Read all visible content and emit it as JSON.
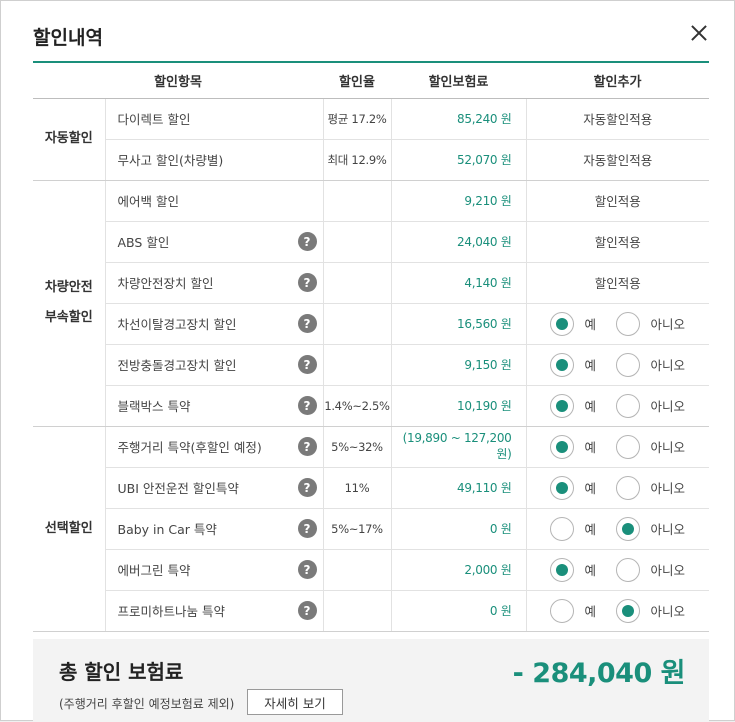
{
  "modal": {
    "title": "할인내역"
  },
  "table": {
    "headers": [
      "할인항목",
      "할인율",
      "할인보험료",
      "할인추가"
    ],
    "groups": [
      {
        "label_lines": [
          "자동할인"
        ],
        "rows": [
          {
            "name": "다이렉트 할인",
            "help": false,
            "rate": "평균 17.2%",
            "amount": "85,240 원",
            "apply": {
              "type": "text",
              "text": "자동할인적용"
            }
          },
          {
            "name": "무사고 할인(차량별)",
            "help": false,
            "rate": "최대 12.9%",
            "amount": "52,070 원",
            "apply": {
              "type": "text",
              "text": "자동할인적용"
            }
          }
        ]
      },
      {
        "label_lines": [
          "차량안전",
          "부속할인"
        ],
        "rows": [
          {
            "name": "에어백 할인",
            "help": false,
            "rate": "",
            "amount": "9,210 원",
            "apply": {
              "type": "text",
              "text": "할인적용"
            }
          },
          {
            "name": "ABS 할인",
            "help": true,
            "rate": "",
            "amount": "24,040 원",
            "apply": {
              "type": "text",
              "text": "할인적용"
            }
          },
          {
            "name": "차량안전장치 할인",
            "help": true,
            "rate": "",
            "amount": "4,140 원",
            "apply": {
              "type": "text",
              "text": "할인적용"
            }
          },
          {
            "name": "차선이탈경고장치 할인",
            "help": true,
            "rate": "",
            "amount": "16,560 원",
            "apply": {
              "type": "radio",
              "selected": "yes"
            }
          },
          {
            "name": "전방충돌경고장치 할인",
            "help": true,
            "rate": "",
            "amount": "9,150 원",
            "apply": {
              "type": "radio",
              "selected": "yes"
            }
          },
          {
            "name": "블랙박스 특약",
            "help": true,
            "rate": "1.4%~2.5%",
            "amount": "10,190 원",
            "apply": {
              "type": "radio",
              "selected": "yes"
            }
          }
        ]
      },
      {
        "label_lines": [
          "선택할인"
        ],
        "rows": [
          {
            "name": "주행거리 특약(후할인 예정)",
            "help": true,
            "rate": "5%~32%",
            "amount": "(19,890 ~ 127,200 원)",
            "apply": {
              "type": "radio",
              "selected": "yes"
            }
          },
          {
            "name": "UBI 안전운전 할인특약",
            "help": true,
            "rate": "11%",
            "amount": "49,110 원",
            "apply": {
              "type": "radio",
              "selected": "yes"
            }
          },
          {
            "name": "Baby in Car 특약",
            "help": true,
            "rate": "5%~17%",
            "amount": "0 원",
            "apply": {
              "type": "radio",
              "selected": "no"
            }
          },
          {
            "name": "에버그린 특약",
            "help": true,
            "rate": "",
            "amount": "2,000 원",
            "apply": {
              "type": "radio",
              "selected": "yes"
            }
          },
          {
            "name": "프로미하트나눔 특약",
            "help": true,
            "rate": "",
            "amount": "0 원",
            "apply": {
              "type": "radio",
              "selected": "no"
            }
          }
        ]
      }
    ],
    "radio_labels": {
      "yes": "예",
      "no": "아니오"
    },
    "help_glyph": "?"
  },
  "summary": {
    "title": "총 할인 보험료",
    "note": "(주행거리 후할인 예정보험료 제외)",
    "detail_button": "자세히 보기",
    "amount": "- 284,040 원"
  },
  "colors": {
    "accent": "#1a8f7b"
  },
  "icons": {
    "close": "close-icon",
    "help": "question-circle-icon"
  }
}
